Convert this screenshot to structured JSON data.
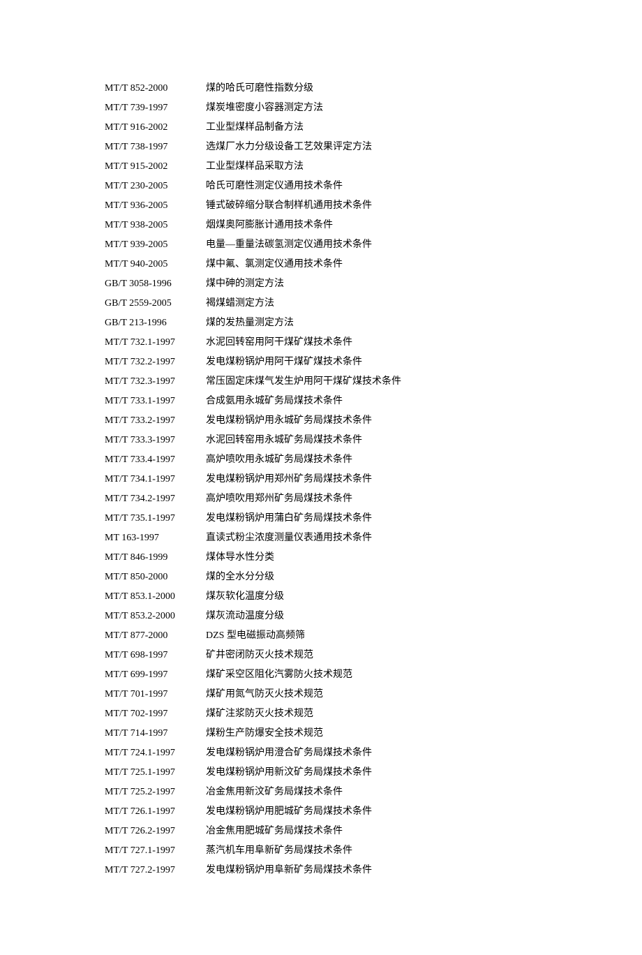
{
  "rows": [
    {
      "code": "MT/T 852-2000",
      "title": "煤的哈氏可磨性指数分级"
    },
    {
      "code": "MT/T 739-1997",
      "title": "煤炭堆密度小容器测定方法"
    },
    {
      "code": "MT/T 916-2002",
      "title": "工业型煤样品制备方法"
    },
    {
      "code": "MT/T 738-1997",
      "title": "选煤厂水力分级设备工艺效果评定方法"
    },
    {
      "code": "MT/T 915-2002",
      "title": "工业型煤样品采取方法"
    },
    {
      "code": "MT/T 230-2005",
      "title": "哈氏可磨性测定仪通用技术条件"
    },
    {
      "code": "MT/T 936-2005",
      "title": "锤式破碎缩分联合制样机通用技术条件"
    },
    {
      "code": "MT/T 938-2005",
      "title": "烟煤奥阿膨胀计通用技术条件"
    },
    {
      "code": "MT/T 939-2005",
      "title": "电量—重量法碳氢测定仪通用技术条件"
    },
    {
      "code": "MT/T 940-2005",
      "title": "煤中氟、氯测定仪通用技术条件"
    },
    {
      "code": "GB/T 3058-1996",
      "title": "煤中砷的测定方法"
    },
    {
      "code": "GB/T 2559-2005",
      "title": "褐煤蜡测定方法"
    },
    {
      "code": "GB/T 213-1996",
      "title": "煤的发热量测定方法"
    },
    {
      "code": "MT/T 732.1-1997",
      "title": "水泥回转窑用阿干煤矿煤技术条件"
    },
    {
      "code": "MT/T 732.2-1997",
      "title": "发电煤粉锅炉用阿干煤矿煤技术条件"
    },
    {
      "code": "MT/T 732.3-1997",
      "title": "常压固定床煤气发生炉用阿干煤矿煤技术条件"
    },
    {
      "code": "MT/T 733.1-1997",
      "title": "合成氨用永城矿务局煤技术条件"
    },
    {
      "code": "MT/T 733.2-1997",
      "title": "发电煤粉锅炉用永城矿务局煤技术条件"
    },
    {
      "code": "MT/T 733.3-1997",
      "title": "水泥回转窑用永城矿务局煤技术条件"
    },
    {
      "code": "MT/T 733.4-1997",
      "title": "高炉喷吹用永城矿务局煤技术条件"
    },
    {
      "code": "MT/T 734.1-1997",
      "title": "发电煤粉锅炉用郑州矿务局煤技术条件"
    },
    {
      "code": "MT/T 734.2-1997",
      "title": "高炉喷吹用郑州矿务局煤技术条件"
    },
    {
      "code": "MT/T 735.1-1997",
      "title": "发电煤粉锅炉用蒲白矿务局煤技术条件"
    },
    {
      "code": "MT 163-1997",
      "title": "直读式粉尘浓度测量仪表通用技术条件"
    },
    {
      "code": "MT/T 846-1999",
      "title": "煤体导水性分类"
    },
    {
      "code": "MT/T 850-2000",
      "title": "煤的全水分分级"
    },
    {
      "code": "MT/T 853.1-2000",
      "title": "煤灰软化温度分级"
    },
    {
      "code": "MT/T 853.2-2000",
      "title": "煤灰流动温度分级"
    },
    {
      "code": "MT/T 877-2000",
      "title": "DZS 型电磁振动高频筛"
    },
    {
      "code": "MT/T 698-1997",
      "title": "矿井密闭防灭火技术规范"
    },
    {
      "code": "MT/T 699-1997",
      "title": "煤矿采空区阻化汽雾防火技术规范"
    },
    {
      "code": "MT/T 701-1997",
      "title": "煤矿用氮气防灭火技术规范"
    },
    {
      "code": "MT/T 702-1997",
      "title": "煤矿注浆防灭火技术规范"
    },
    {
      "code": "MT/T 714-1997",
      "title": "煤粉生产防爆安全技术规范"
    },
    {
      "code": "MT/T 724.1-1997",
      "title": "发电煤粉锅炉用澄合矿务局煤技术条件"
    },
    {
      "code": "MT/T 725.1-1997",
      "title": "发电煤粉锅炉用新汶矿务局煤技术条件"
    },
    {
      "code": "MT/T 725.2-1997",
      "title": "冶金焦用新汶矿务局煤技术条件"
    },
    {
      "code": "MT/T 726.1-1997",
      "title": "发电煤粉锅炉用肥城矿务局煤技术条件"
    },
    {
      "code": "MT/T 726.2-1997",
      "title": "冶金焦用肥城矿务局煤技术条件"
    },
    {
      "code": "MT/T 727.1-1997",
      "title": "蒸汽机车用阜新矿务局煤技术条件"
    },
    {
      "code": "MT/T 727.2-1997",
      "title": "发电煤粉锅炉用阜新矿务局煤技术条件"
    }
  ]
}
